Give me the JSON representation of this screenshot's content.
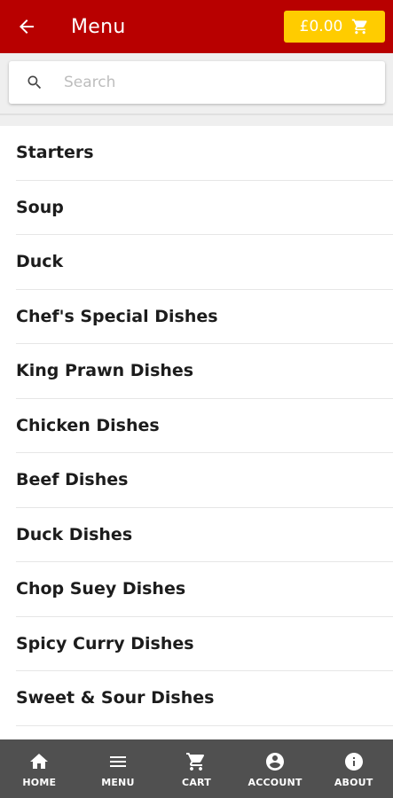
{
  "appbar": {
    "title": "Menu",
    "cart_total": "£0.00",
    "back_icon": "arrow-left-icon",
    "cart_icon": "cart-icon"
  },
  "search": {
    "placeholder": "Search",
    "value": ""
  },
  "categories": [
    {
      "label": "Starters"
    },
    {
      "label": "Soup"
    },
    {
      "label": "Duck"
    },
    {
      "label": "Chef's Special Dishes"
    },
    {
      "label": "King Prawn Dishes"
    },
    {
      "label": "Chicken Dishes"
    },
    {
      "label": "Beef Dishes"
    },
    {
      "label": "Duck Dishes"
    },
    {
      "label": "Chop Suey Dishes"
    },
    {
      "label": "Spicy Curry Dishes"
    },
    {
      "label": "Sweet & Sour Dishes"
    },
    {
      "label": ""
    }
  ],
  "bottom_nav": [
    {
      "label": "HOME",
      "icon": "home-icon"
    },
    {
      "label": "MENU",
      "icon": "menu-icon"
    },
    {
      "label": "CART",
      "icon": "cart-icon"
    },
    {
      "label": "ACCOUNT",
      "icon": "account-icon"
    },
    {
      "label": "ABOUT",
      "icon": "info-icon"
    }
  ],
  "colors": {
    "appbar": "#b80000",
    "cart_pill": "#ffcc00",
    "bottom_nav": "#505050"
  }
}
